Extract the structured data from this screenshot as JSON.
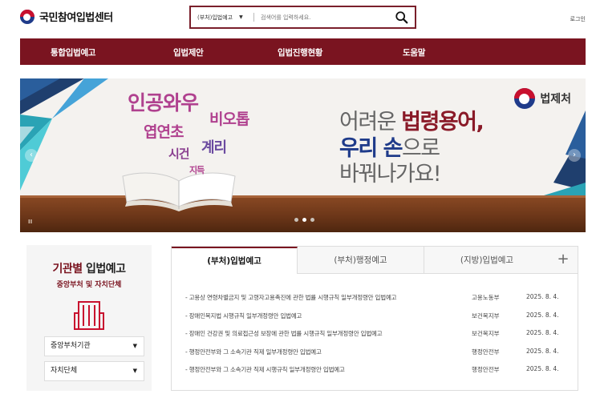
{
  "header": {
    "site_name": "국민참여입법센터",
    "search_scope": "(부처)입법예고",
    "search_placeholder": "검색어를 입력하세요.",
    "login_label": "로그인"
  },
  "nav": {
    "items": [
      "통합입법예고",
      "입법제안",
      "입법진행현황",
      "도움말"
    ]
  },
  "banner": {
    "words": {
      "w1": "인공와우",
      "w2": "비오톱",
      "w3": "엽연초",
      "w4": "계리",
      "w5": "시건",
      "w6": "지득"
    },
    "line1_a": "어려운 ",
    "line1_b": "법령용어,",
    "line2_a": "우리 ",
    "line2_b": "손",
    "line2_c": "으로",
    "line3": "바꿔나가요!",
    "brand": "법제처",
    "prev_arrow": "‹",
    "next_arrow": "›",
    "pause_label": "II",
    "slide_count": 3,
    "active_slide": 1,
    "colors": {
      "maroon": "#7a1420",
      "navy": "#1f3b8a",
      "pink": "#b0418f",
      "purple": "#6b4aa0"
    }
  },
  "agency_panel": {
    "title_a": "기관별 ",
    "title_b": "입법예고",
    "subtitle": "중앙부처 및 자치단체",
    "icon": "building-icon",
    "select1": "중앙부처기관",
    "select2": "자치단체"
  },
  "tabs": {
    "items": [
      "(부처)입법예고",
      "(부처)행정예고",
      "(지방)입법예고"
    ],
    "active": 0,
    "plus": "+"
  },
  "notices": [
    {
      "title": "- 고용상 연령차별금지 및 고령자고용촉진에 관한 법률 시행규칙 일부개정령안 입법예고",
      "agency": "고용노동부",
      "date": "2025. 8. 4."
    },
    {
      "title": "- 장애인복지법 시행규칙 일부개정령안 입법예고",
      "agency": "보건복지부",
      "date": "2025. 8. 4."
    },
    {
      "title": "- 장애인 건강권 및 의료접근성 보장에 관한 법률 시행규칙 일부개정령안 입법예고",
      "agency": "보건복지부",
      "date": "2025. 8. 4."
    },
    {
      "title": "- 행정안전부와 그 소속기관 직제 일부개정령안 입법예고",
      "agency": "행정안전부",
      "date": "2025. 8. 4."
    },
    {
      "title": "- 행정안전부와 그 소속기관 직제 시행규칙 일부개정령안 입법예고",
      "agency": "행정안전부",
      "date": "2025. 8. 4."
    }
  ]
}
